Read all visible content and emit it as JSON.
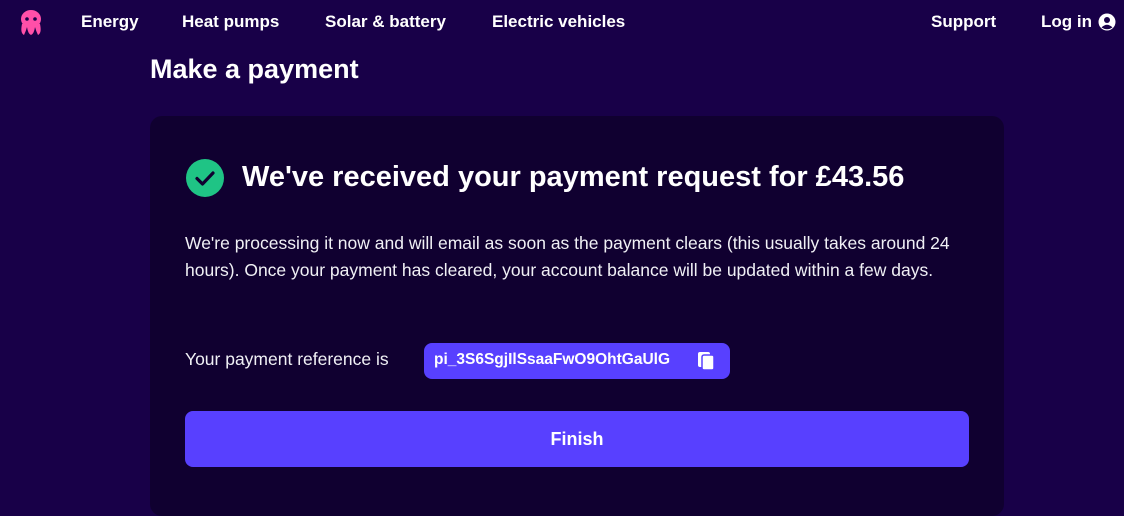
{
  "nav": {
    "logo_icon": "octopus-logo-icon",
    "links": [
      "Energy",
      "Heat pumps",
      "Solar & battery",
      "Electric vehicles"
    ],
    "support": "Support",
    "login": "Log in",
    "login_icon": "user-circle-icon"
  },
  "page": {
    "title": "Make a payment"
  },
  "confirmation": {
    "icon": "check-circle-icon",
    "heading": "We've received your payment request for £43.56",
    "body": "We're processing it now and will email as soon as the payment clears (this usually takes around 24 hours). Once your payment has cleared, your account balance will be updated within a few days.",
    "reference_label": "Your payment reference is",
    "reference_code": "pi_3S6SgjIlSsaaFwO9OhtGaUlG",
    "copy_icon": "copy-icon",
    "finish_label": "Finish"
  },
  "colors": {
    "background": "#180048",
    "card": "#100030",
    "accent": "#5840ff",
    "success": "#1fc485",
    "logo": "#ff4fa8"
  }
}
